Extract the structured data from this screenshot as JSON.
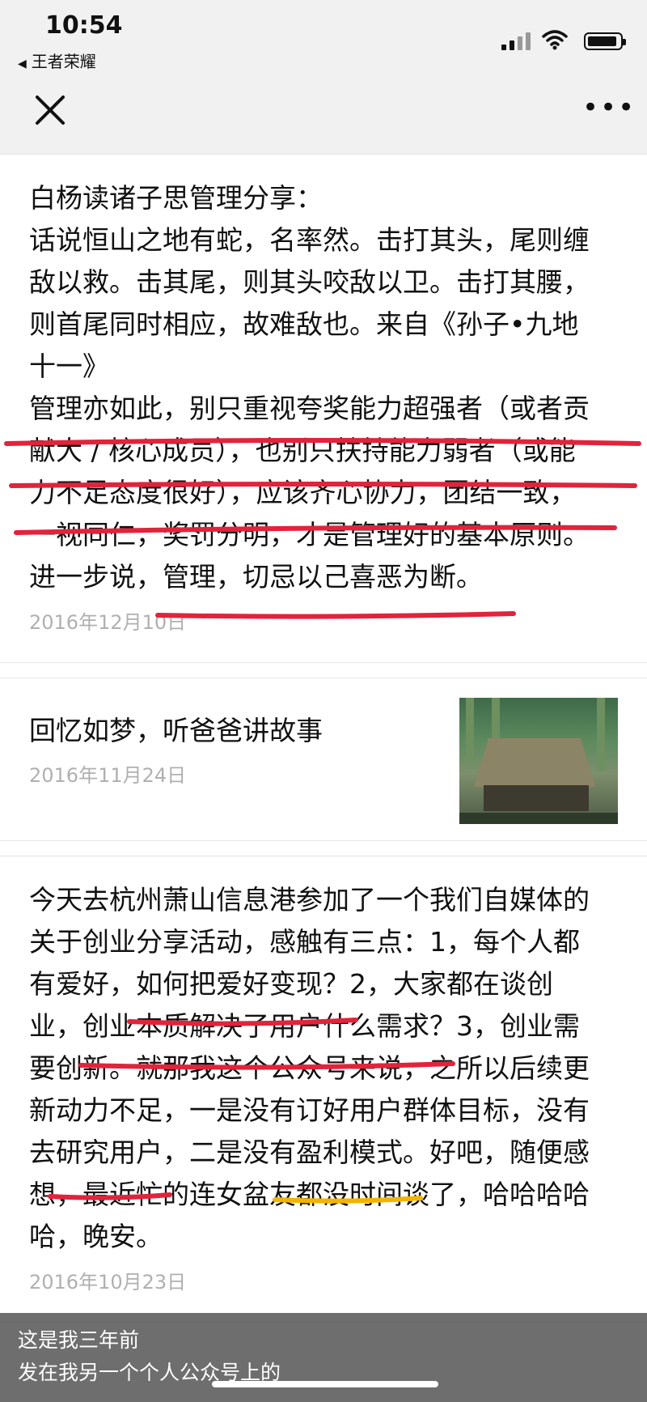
{
  "status_bar": {
    "time": "10:54",
    "back_app": "王者荣耀"
  },
  "nav": {
    "close_icon": "close-icon",
    "more_icon": "more-icon"
  },
  "posts": [
    {
      "text": "白杨读诸子思管理分享：\n话说恒山之地有蛇，名率然。击打其头，尾则缠\n敌以救。击其尾，则其头咬敌以卫。击打其腰，\n则首尾同时相应，故难敌也。来自《孙子•九地\n十一》\n管理亦如此，别只重视夸奖能力超强者（或者贡\n献大 / 核心成员），也别只扶持能力弱者（或能\n力不足态度很好），应该齐心协力，团结一致，\n一视同仁，奖罚分明，才是管理好的基本原则。\n进一步说，管理，切忌以己喜恶为断。",
      "date": "2016年12月10日"
    },
    {
      "title": "回忆如梦，听爸爸讲故事",
      "date": "2016年11月24日"
    },
    {
      "text": "今天去杭州萧山信息港参加了一个我们自媒体的\n关于创业分享活动，感触有三点：1，每个人都\n有爱好，如何把爱好变现？2，大家都在谈创\n业，创业本质解决了用户什么需求？3，创业需\n要创新。就那我这个公众号来说，之所以后续更\n新动力不足，一是没有订好用户群体目标，没有\n去研究用户，二是没有盈利模式。好吧，随便感\n想，最近忙的连女盆友都没时间谈了，哈哈哈哈\n哈，晚安。",
      "date": "2016年10月23日"
    }
  ],
  "caption": {
    "line1": "这是我三年前",
    "line2": "发在我另一个个人公众号上的"
  },
  "colors": {
    "underline_red": "#e2233b",
    "underline_yellow": "#f2b400"
  }
}
